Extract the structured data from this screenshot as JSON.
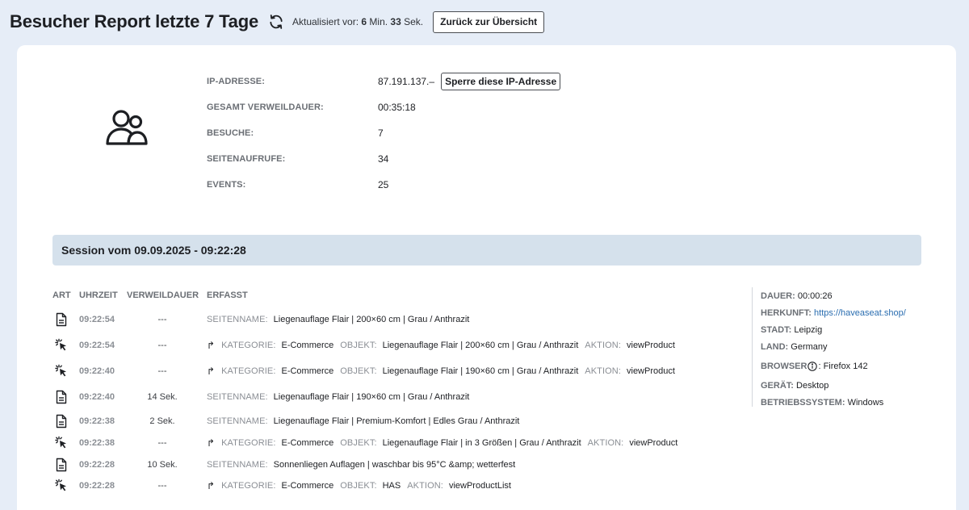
{
  "header": {
    "title": "Besucher Report letzte 7 Tage",
    "updated_prefix": "Aktualisiert vor:",
    "updated_min": "6",
    "min_label": "Min.",
    "updated_sec": "33",
    "sec_label": "Sek.",
    "back_label": "Zurück zur Übersicht"
  },
  "visitor": {
    "ip_label": "IP-ADRESSE:",
    "ip_value": "87.191.137.–",
    "block_label": "Sperre diese IP-Adresse",
    "total_label": "GESAMT VERWEILDAUER:",
    "total_value": "00:35:18",
    "visits_label": "BESUCHE:",
    "visits_value": "7",
    "pageviews_label": "SEITENAUFRUFE:",
    "pageviews_value": "34",
    "events_label": "EVENTS:",
    "events_value": "25"
  },
  "session": {
    "title": "Session vom 09.09.2025 - 09:22:28",
    "columns": [
      "ART",
      "UHRZEIT",
      "VERWEILDAUER",
      "ERFASST"
    ],
    "rows": [
      {
        "type": "page",
        "time": "09:22:54",
        "duration": "---",
        "pagename_key": "SEITENNAME:",
        "pagename": "Liegenauflage Flair | 200×60 cm | Grau / Anthrazit"
      },
      {
        "type": "event",
        "time": "09:22:54",
        "duration": "---",
        "cat_key": "KATEGORIE:",
        "cat": "E-Commerce",
        "obj_key": "OBJEKT:",
        "obj": "Liegenauflage Flair | 200×60 cm | Grau / Anthrazit",
        "act_key": "AKTION:",
        "act": "viewProduct"
      },
      {
        "type": "event",
        "time": "09:22:40",
        "duration": "---",
        "cat_key": "KATEGORIE:",
        "cat": "E-Commerce",
        "obj_key": "OBJEKT:",
        "obj": "Liegenauflage Flair | 190×60 cm | Grau / Anthrazit",
        "act_key": "AKTION:",
        "act": "viewProduct"
      },
      {
        "type": "page",
        "time": "09:22:40",
        "duration": "14 Sek.",
        "pagename_key": "SEITENNAME:",
        "pagename": "Liegenauflage Flair | 190×60 cm | Grau / Anthrazit"
      },
      {
        "type": "page",
        "time": "09:22:38",
        "duration": "2 Sek.",
        "pagename_key": "SEITENNAME:",
        "pagename": "Liegenauflage Flair | Premium-Komfort | Edles Grau / Anthrazit"
      },
      {
        "type": "event",
        "time": "09:22:38",
        "duration": "---",
        "cat_key": "KATEGORIE:",
        "cat": "E-Commerce",
        "obj_key": "OBJEKT:",
        "obj": "Liegenauflage Flair | in 3 Größen | Grau / Anthrazit",
        "act_key": "AKTION:",
        "act": "viewProduct"
      },
      {
        "type": "page",
        "time": "09:22:28",
        "duration": "10 Sek.",
        "pagename_key": "SEITENNAME:",
        "pagename": "Sonnenliegen Auflagen | waschbar bis 95°C &amp; wetterfest"
      },
      {
        "type": "event",
        "time": "09:22:28",
        "duration": "---",
        "cat_key": "KATEGORIE:",
        "cat": "E-Commerce",
        "obj_key": "OBJEKT:",
        "obj": "HAS",
        "act_key": "AKTION:",
        "act": "viewProductList"
      }
    ],
    "details": {
      "dauer_label": "DAUER:",
      "dauer_value": "00:00:26",
      "herkunft_label": "HERKUNFT:",
      "herkunft_value": "https://haveaseat.shop/",
      "stadt_label": "STADT:",
      "stadt_value": "Leipzig",
      "land_label": "LAND:",
      "land_value": "Germany",
      "browser_label": "BROWSER",
      "browser_value": ": Firefox 142",
      "geraet_label": "GERÄT:",
      "geraet_value": "Desktop",
      "os_label": "BETRIEBSSYSTEM:",
      "os_value": "Windows"
    }
  },
  "icons": {
    "refresh": "refresh-icon",
    "users": "users-icon",
    "page": "document-icon",
    "event": "click-icon",
    "redirect": "redirect-arrow-icon",
    "info": "info-icon"
  },
  "colors": {
    "background": "#e6edf7",
    "session_bar": "#d5e1ec",
    "link": "#2a6db0",
    "muted": "#8a8e94"
  }
}
